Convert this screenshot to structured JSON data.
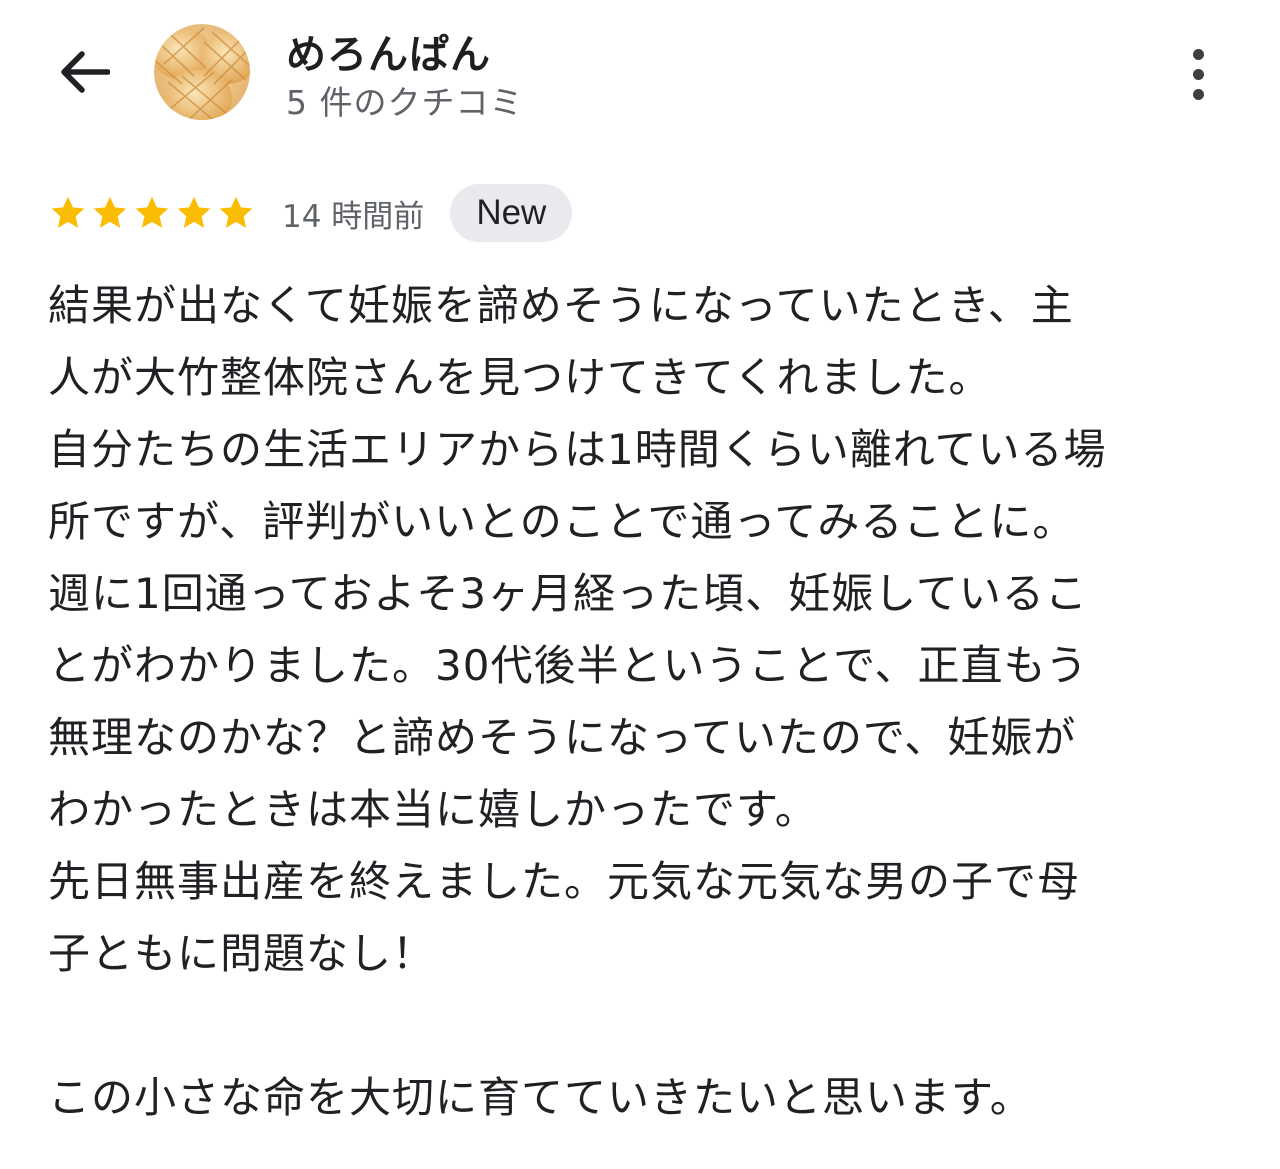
{
  "header": {
    "author_name": "めろんぱん",
    "review_count": "5 件のクチコミ",
    "back_icon": "arrow-back-icon",
    "more_icon": "more-vert-icon"
  },
  "review": {
    "rating": 5,
    "max_rating": 5,
    "star_color": "#fbbc04",
    "time_ago": "14 時間前",
    "badge": "New",
    "lines": [
      "結果が出なくて妊娠を諦めそうになっていたとき、主",
      "人が大竹整体院さんを見つけてきてくれました。",
      "自分たちの生活エリアからは1時間くらい離れている場",
      "所ですが、評判がいいとのことで通ってみることに。",
      "週に1回通っておよそ3ヶ月経った頃、妊娠しているこ",
      "とがわかりました。30代後半ということで、正直もう",
      "無理なのかな？と諦めそうになっていたので、妊娠が",
      "わかったときは本当に嬉しかったです。",
      "先日無事出産を終えました。元気な元気な男の子で母",
      "子ともに問題なし！",
      "",
      "この小さな命を大切に育てていきたいと思います。"
    ]
  }
}
